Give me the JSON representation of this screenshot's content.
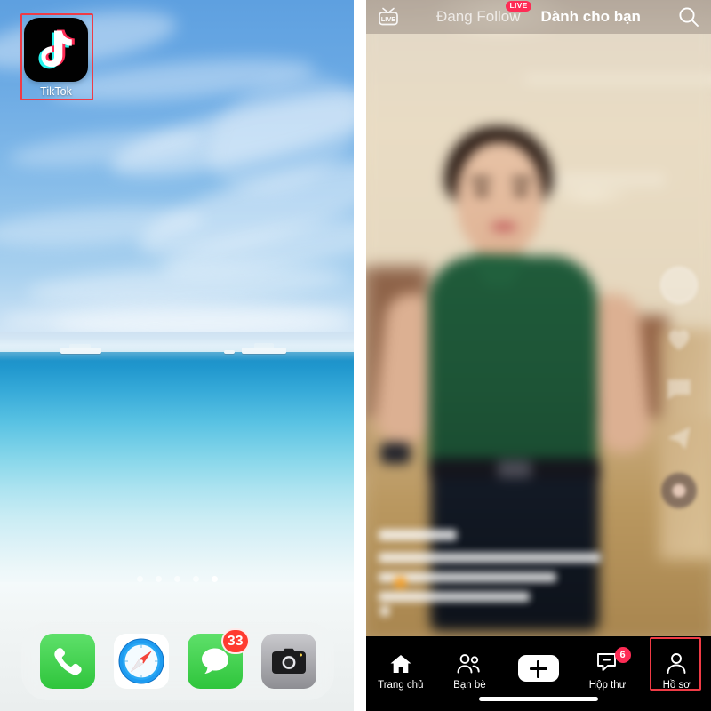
{
  "home_screen": {
    "app_icon": {
      "name": "TikTok",
      "icon": "tiktok-logo-icon"
    },
    "page_dots": {
      "count": 5,
      "active_index": 4
    },
    "dock": [
      {
        "label": "Phone",
        "icon": "phone-icon"
      },
      {
        "label": "Safari",
        "icon": "safari-compass-icon"
      },
      {
        "label": "Messages",
        "icon": "message-bubble-icon",
        "badge": "33"
      },
      {
        "label": "Camera",
        "icon": "camera-icon"
      }
    ],
    "wallpaper": "beach-sea-sky-photo"
  },
  "tiktok_app": {
    "header": {
      "live_icon_label": "LIVE",
      "tabs": [
        {
          "label": "Đang Follow",
          "active": false,
          "badge": "LIVE"
        },
        {
          "label": "Dành cho bạn",
          "active": true,
          "badge": ""
        }
      ],
      "search_icon": "search-icon"
    },
    "bottom_nav": [
      {
        "label": "Trang chủ",
        "icon": "home-icon",
        "active": true,
        "badge": ""
      },
      {
        "label": "Bạn bè",
        "icon": "friends-icon",
        "active": false,
        "badge": ""
      },
      {
        "label": "",
        "icon": "create-plus-icon",
        "active": false,
        "badge": ""
      },
      {
        "label": "Hộp thư",
        "icon": "inbox-message-icon",
        "active": false,
        "badge": "6"
      },
      {
        "label": "Hồ sơ",
        "icon": "profile-person-icon",
        "active": false,
        "badge": ""
      }
    ]
  },
  "annotations": {
    "highlight_color": "#ef3b46",
    "boxes": [
      {
        "target": "tiktok-app-icon"
      },
      {
        "target": "profile-nav-item"
      }
    ]
  },
  "colors": {
    "tiktok_pink": "#fe2c55",
    "tiktok_cyan": "#25f4ee",
    "ios_badge_red": "#ff3b30",
    "highlight_red": "#ef3b46"
  }
}
